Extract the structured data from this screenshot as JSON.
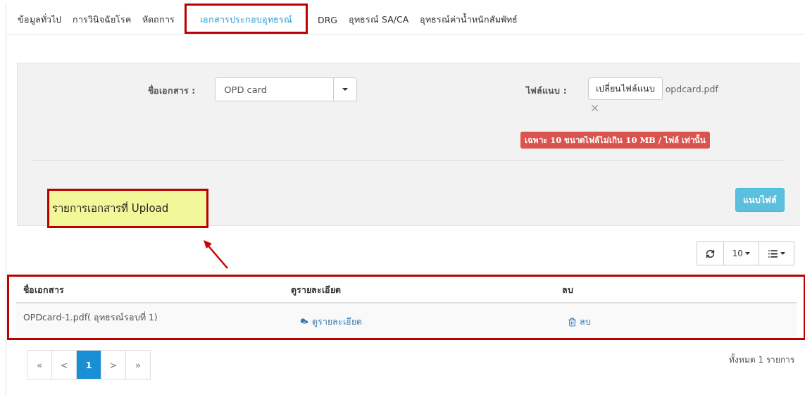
{
  "tabs": [
    {
      "label": "ข้อมูลทั่วไป",
      "selected": false
    },
    {
      "label": "การวินิจฉัยโรค",
      "selected": false
    },
    {
      "label": "หัตถการ",
      "selected": false
    },
    {
      "label": "เอกสารประกอบอุทธรณ์",
      "selected": true
    },
    {
      "label": "DRG",
      "selected": false
    },
    {
      "label": "อุทธรณ์ SA/CA",
      "selected": false
    },
    {
      "label": "อุทธรณ์ค่าน้ำหนักสัมพัทธ์",
      "selected": false
    }
  ],
  "form": {
    "doc_label": "ชื่อเอกสาร :",
    "doc_value": "OPD card",
    "file_label": "ไฟล์แนบ :",
    "change_button": "เปลี่ยนไฟล์แนบ",
    "file_name": "opdcard.pdf",
    "limit_note": "เฉพาะ 10 ขนาดไฟล์ไม่เกิน 10 MB / ไฟล์ เท่านั้น",
    "attach_button": "แนบไฟล์"
  },
  "callout": "รายการเอกสารที่ Upload",
  "toolbar": {
    "page_size": "10"
  },
  "table": {
    "columns": [
      "ชื่อเอกสาร",
      "ดูรายละเอียด",
      "ลบ"
    ],
    "rows": [
      {
        "name": "OPDcard-1.pdf( อุทธรณ์รอบที่ 1)",
        "view": "ดูรายละเอียด",
        "delete": "ลบ"
      }
    ]
  },
  "pagination": [
    {
      "label": "«",
      "selected": false
    },
    {
      "label": "<",
      "selected": false
    },
    {
      "label": "1",
      "selected": true
    },
    {
      "label": ">",
      "selected": false
    },
    {
      "label": "»",
      "selected": false
    }
  ],
  "total": "ทั้งหมด 1 รายการ"
}
